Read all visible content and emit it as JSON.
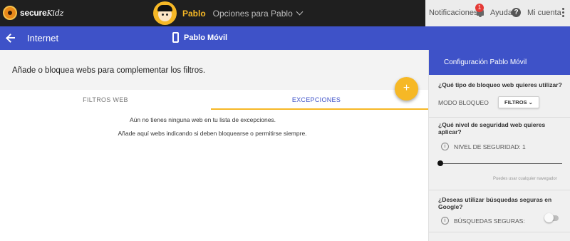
{
  "topbar": {
    "logo_text": "secure",
    "logo_text_kids": "Kidz",
    "profile_name": "Pablo",
    "profile_options": "Opciones para Pablo",
    "notifications_label": "Notificaciones",
    "notifications_count": "1",
    "help_label": "Ayuda",
    "help_icon": "?",
    "account_label": "Mi cuenta"
  },
  "header": {
    "section_title": "Internet",
    "device_name": "Pablo Móvil"
  },
  "main": {
    "intro": "Añade o bloquea webs para complementar los filtros.",
    "tabs": [
      {
        "label": "FILTROS WEB"
      },
      {
        "label": "EXCEPCIONES"
      }
    ],
    "fab_label": "+",
    "empty_line1": "Aún no tienes ninguna web en tu lista de excepciones.",
    "empty_line2": "Añade aquí webs indicando si deben bloquearse o permitirse siempre."
  },
  "panel": {
    "title": "Configuración Pablo Móvil",
    "q_block_type": "¿Qué tipo de bloqueo web quieres utilizar?",
    "mode_label": "MODO BLOQUEO",
    "mode_value": "FILTROS",
    "q_security_level": "¿Qué nivel de seguridad web quieres aplicar?",
    "level_label": "NIVEL DE SEGURIDAD: 1",
    "slider_hint": "Puedes usar cualquier navegador",
    "q_safe_search": "¿Deseas utilizar búsquedas seguras en Google?",
    "safe_search_label": "BÚSQUEDAS SEGURAS:",
    "safe_search_enabled": false,
    "security_level": 1
  },
  "colors": {
    "brand_blue": "#3e52c8",
    "accent_yellow": "#f6b826",
    "topbar_dark": "#1f1f1f",
    "badge_red": "#e53935"
  }
}
